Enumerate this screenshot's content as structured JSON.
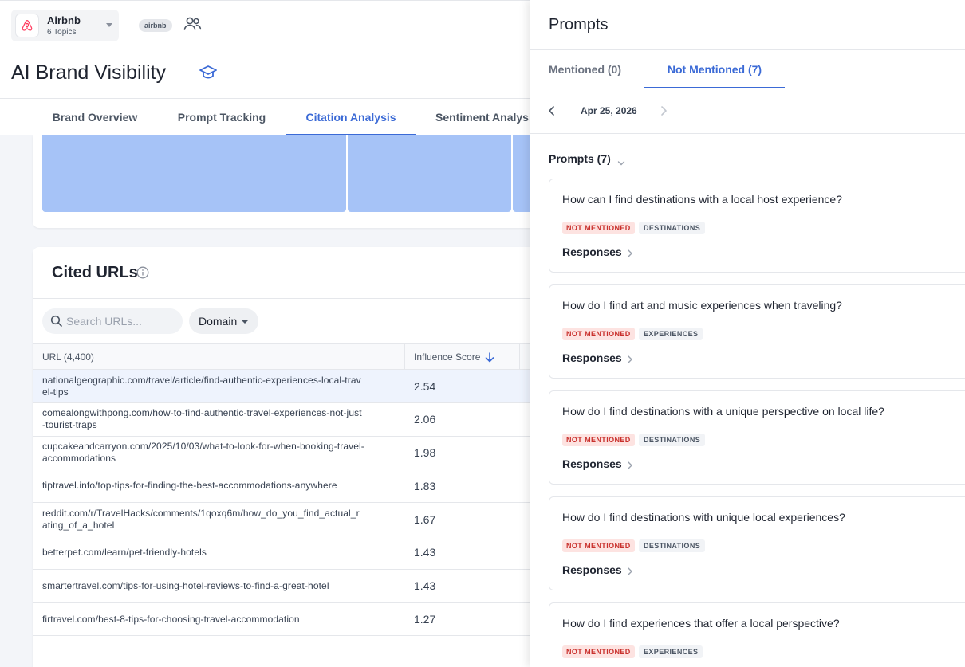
{
  "brand": {
    "name": "Airbnb",
    "topics": "6 Topics",
    "tag": "airbnb"
  },
  "page": {
    "title": "AI Brand Visibility"
  },
  "tabs": [
    {
      "label": "Brand Overview"
    },
    {
      "label": "Prompt Tracking"
    },
    {
      "label": "Citation Analysis",
      "active": true
    },
    {
      "label": "Sentiment Analysis"
    }
  ],
  "cited_urls": {
    "title": "Cited URLs",
    "search": {
      "placeholder": "Search URLs...",
      "value": ""
    },
    "domain_filter": "Domain",
    "columns": {
      "url": "URL (4,400)",
      "score": "Influence Score"
    },
    "rows": [
      {
        "url": "nationalgeographic.com/travel/article/find-authentic-experiences-local-travel-tips",
        "score": "2.54"
      },
      {
        "url": "comealongwithpong.com/how-to-find-authentic-travel-experiences-not-just-tourist-traps",
        "score": "2.06"
      },
      {
        "url": "cupcakeandcarryon.com/2025/10/03/what-to-look-for-when-booking-travel-accommodations",
        "score": "1.98"
      },
      {
        "url": "tiptravel.info/top-tips-for-finding-the-best-accommodations-anywhere",
        "score": "1.83"
      },
      {
        "url": "reddit.com/r/TravelHacks/comments/1qoxq6m/how_do_you_find_actual_rating_of_a_hotel",
        "score": "1.67"
      },
      {
        "url": "betterpet.com/learn/pet-friendly-hotels",
        "score": "1.43"
      },
      {
        "url": "smartertravel.com/tips-for-using-hotel-reviews-to-find-a-great-hotel",
        "score": "1.43"
      },
      {
        "url": "firtravel.com/best-8-tips-for-choosing-travel-accommodation",
        "score": "1.27"
      }
    ]
  },
  "panel": {
    "title": "Prompts",
    "tabs": [
      {
        "label": "Mentioned (0)"
      },
      {
        "label": "Not Mentioned (7)",
        "active": true
      }
    ],
    "date": "Apr 25, 2026",
    "prompts_header": "Prompts (7)",
    "responses_label": "Responses",
    "status_label": "NOT MENTIONED",
    "prompts": [
      {
        "question": "How can I find destinations with a local host experience?",
        "category": "DESTINATIONS"
      },
      {
        "question": "How do I find art and music experiences when traveling?",
        "category": "EXPERIENCES"
      },
      {
        "question": "How do I find destinations with a unique perspective on local life?",
        "category": "DESTINATIONS"
      },
      {
        "question": "How do I find destinations with unique local experiences?",
        "category": "DESTINATIONS"
      },
      {
        "question": "How do I find experiences that offer a local perspective?",
        "category": "EXPERIENCES"
      }
    ]
  },
  "colors": {
    "accent": "#3b6ad6",
    "tile": "#a6c3f7",
    "not_mentioned_bg": "#fde3e1",
    "not_mentioned_text": "#c9302c",
    "airbnb": "#ff385c"
  }
}
